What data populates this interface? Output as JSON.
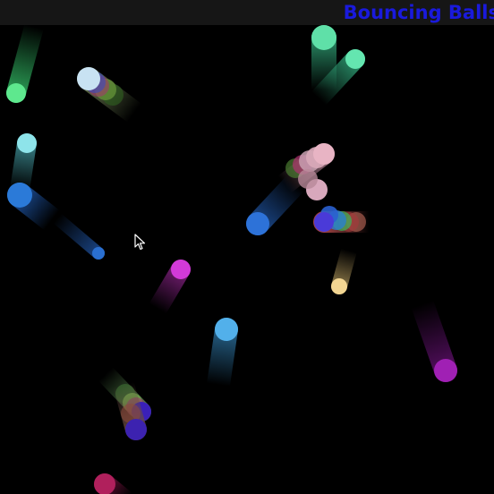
{
  "app": {
    "title": "Bouncing Balls",
    "title_color": "#1a1adc",
    "header_color": "#161616",
    "background_color": "#000000"
  },
  "balls": [
    {
      "id": "ball-green-left",
      "color": "#5ee88e",
      "trail": "#2fae5e"
    },
    {
      "id": "ball-mint-top-1",
      "color": "#5fe0a8",
      "trail": "#2d9a70"
    },
    {
      "id": "ball-mint-top-2",
      "color": "#64e6b0",
      "trail": "#2e9e74"
    },
    {
      "id": "ball-lightblue-top-left",
      "color": "#c8e2f2",
      "trail": "#6a7a50"
    },
    {
      "id": "ball-cyan-left",
      "color": "#8ee4ea",
      "trail": "#3d8d94"
    },
    {
      "id": "ball-blue-left",
      "color": "#2b7ad8",
      "trail": "#1d52a0"
    },
    {
      "id": "ball-blue-small",
      "color": "#2a6fd0",
      "trail": "#1c4a90"
    },
    {
      "id": "ball-pink-right",
      "color": "#e8b4c4",
      "trail": "#9c7080"
    },
    {
      "id": "ball-blue-center",
      "color": "#2d72d8",
      "trail": "#1d4e96"
    },
    {
      "id": "ball-indigo-right",
      "color": "#4a3ad8",
      "trail": "#b04a4a"
    },
    {
      "id": "ball-cream",
      "color": "#f2d592",
      "trail": "#9a8450"
    },
    {
      "id": "ball-magenta",
      "color": "#d23ad8",
      "trail": "#80207e"
    },
    {
      "id": "ball-skyblue",
      "color": "#52b0ea",
      "trail": "#2a6c98"
    },
    {
      "id": "ball-purple-right",
      "color": "#a020b4",
      "trail": "#5c1068"
    },
    {
      "id": "ball-indigo-bottom-1",
      "color": "#3a20b8",
      "trail": "#5a8a50"
    },
    {
      "id": "ball-indigo-bottom-2",
      "color": "#3c22b0",
      "trail": "#6a4a40"
    },
    {
      "id": "ball-crimson-bottom",
      "color": "#b0205c",
      "trail": "#6a1038"
    }
  ],
  "cursor": {
    "icon": "arrow-cursor-icon"
  }
}
